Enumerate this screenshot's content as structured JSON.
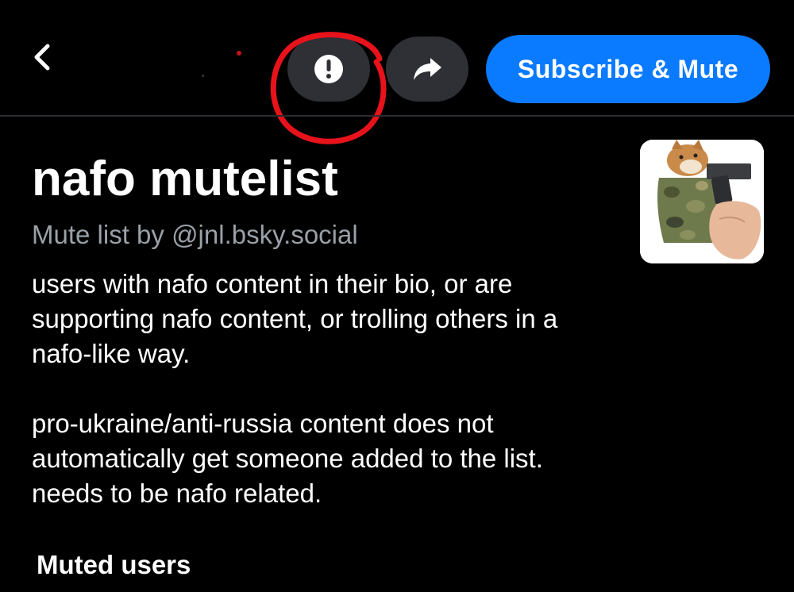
{
  "header": {
    "back_icon": "chevron-left-icon",
    "report_icon": "alert-circle-icon",
    "share_icon": "share-arrow-icon",
    "subscribe_label": "Subscribe & Mute",
    "accent_color": "#0a7aff",
    "button_bg_color": "#2e3036",
    "annotation_color": "#e8121b"
  },
  "list": {
    "title": "nafo mutelist",
    "byline_prefix": "Mute list by ",
    "author_handle": "@jnl.bsky.social",
    "description": [
      "users with nafo content in their bio, or are supporting nafo content, or trolling others in a nafo-like way.",
      "pro-ukraine/anti-russia content does not automatically get someone added to the list. needs to be nafo related."
    ],
    "avatar_icon": "list-avatar-image"
  },
  "sections": {
    "muted_users_heading": "Muted users"
  }
}
